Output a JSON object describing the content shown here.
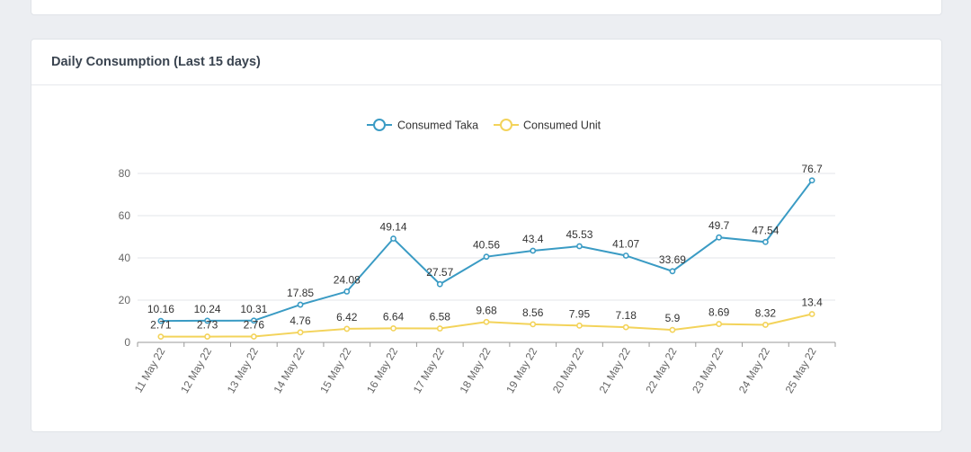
{
  "card": {
    "title": "Daily Consumption (Last 15 days)"
  },
  "chart_data": {
    "type": "line",
    "title": "",
    "xlabel": "",
    "ylabel": "",
    "ylim": [
      0,
      80
    ],
    "yticks": [
      0,
      20,
      40,
      60,
      80
    ],
    "grid": true,
    "legend_position": "top-center",
    "categories": [
      "11 May 22",
      "12 May 22",
      "13 May 22",
      "14 May 22",
      "15 May 22",
      "16 May 22",
      "17 May 22",
      "18 May 22",
      "19 May 22",
      "20 May 22",
      "21 May 22",
      "22 May 22",
      "23 May 22",
      "24 May 22",
      "25 May 22"
    ],
    "series": [
      {
        "name": "Consumed Taka",
        "color": "#3a9bc4",
        "values": [
          10.16,
          10.24,
          10.31,
          17.85,
          24.08,
          49.14,
          27.57,
          40.56,
          43.4,
          45.53,
          41.07,
          33.69,
          49.7,
          47.54,
          76.7
        ]
      },
      {
        "name": "Consumed Unit",
        "color": "#f3d35a",
        "values": [
          2.71,
          2.73,
          2.76,
          4.76,
          6.42,
          6.64,
          6.58,
          9.68,
          8.56,
          7.95,
          7.18,
          5.9,
          8.69,
          8.32,
          13.4
        ]
      }
    ]
  }
}
